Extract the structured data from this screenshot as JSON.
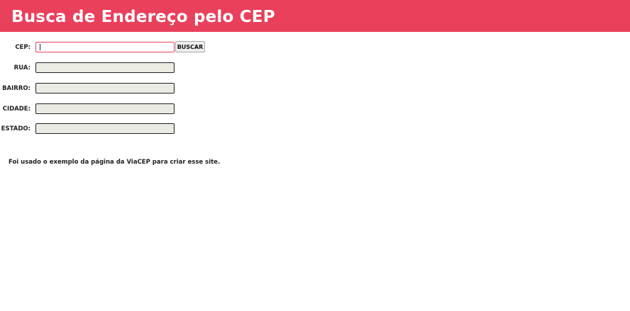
{
  "header": {
    "title": "Busca de Endereço pelo CEP"
  },
  "form": {
    "cep": {
      "label": "CEP:",
      "value": "",
      "placeholder": ""
    },
    "buscar_label": "BUSCAR",
    "rua": {
      "label": "RUA:",
      "value": ""
    },
    "bairro": {
      "label": "BAIRRO:",
      "value": ""
    },
    "cidade": {
      "label": "CIDADE:",
      "value": ""
    },
    "estado": {
      "label": "ESTADO:",
      "value": ""
    }
  },
  "note": "Foi usado o exemplo da página da ViaCEP para criar esse site.",
  "colors": {
    "header_bg": "#e9405c",
    "disabled_field_bg": "#ebebe4"
  }
}
